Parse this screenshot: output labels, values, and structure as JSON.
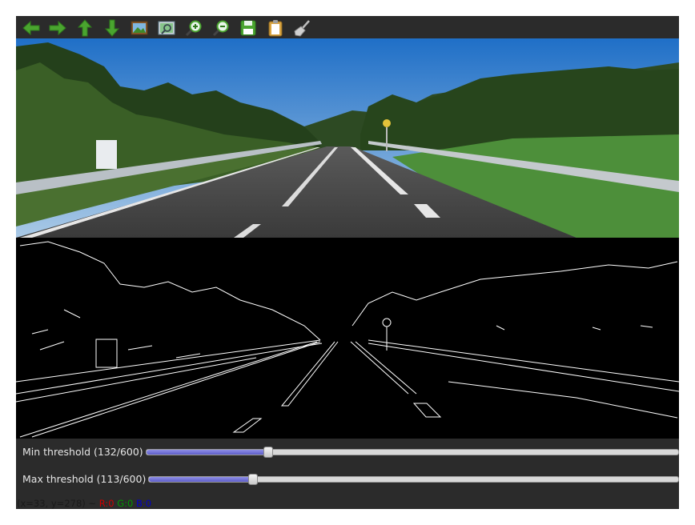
{
  "toolbar": {
    "buttons": [
      {
        "name": "pan-left",
        "icon": "arrow-left-icon"
      },
      {
        "name": "pan-right",
        "icon": "arrow-right-icon"
      },
      {
        "name": "pan-up",
        "icon": "arrow-up-icon"
      },
      {
        "name": "pan-down",
        "icon": "arrow-down-icon"
      },
      {
        "name": "zoom-original",
        "icon": "image-icon"
      },
      {
        "name": "zoom-fit",
        "icon": "image-fit-icon"
      },
      {
        "name": "zoom-in",
        "icon": "zoom-in-icon"
      },
      {
        "name": "zoom-out",
        "icon": "zoom-out-icon"
      },
      {
        "name": "save",
        "icon": "floppy-disk-icon"
      },
      {
        "name": "properties",
        "icon": "clipboard-icon"
      },
      {
        "name": "clear",
        "icon": "broom-icon"
      }
    ]
  },
  "trackbars": {
    "min": {
      "label": "Min threshold (132/600)",
      "value": 132,
      "max": 600
    },
    "max": {
      "label": "Max threshold (113/600)",
      "value": 113,
      "max": 600
    }
  },
  "status": {
    "coords": "(x=33, y=278) ~",
    "r": "R:0",
    "g": "G:0",
    "b": "B:0"
  },
  "colors": {
    "toolbar_bg": "#2b2b2b",
    "icon_green": "#49a32e",
    "r_color": "#cc0000",
    "g_color": "#009900",
    "b_color": "#0000cc"
  }
}
